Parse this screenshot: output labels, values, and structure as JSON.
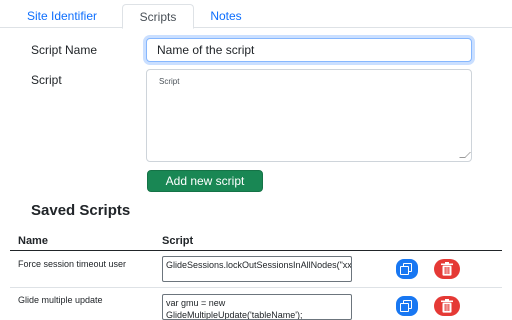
{
  "tabs": [
    {
      "label": "Site Identifier",
      "active": false
    },
    {
      "label": "Scripts",
      "active": true
    },
    {
      "label": "Notes",
      "active": false
    }
  ],
  "form": {
    "script_name_label": "Script Name",
    "script_name_placeholder": "Name of the script",
    "script_label": "Script",
    "script_placeholder": "Script",
    "add_button_label": "Add new script"
  },
  "saved": {
    "title": "Saved Scripts",
    "columns": [
      "Name",
      "Script"
    ],
    "rows": [
      {
        "name": "Force session timeout user",
        "script": "GlideSessions.lockOutSessionsInAllNodes(\"xxxxx\");"
      },
      {
        "name": "Glide multiple update",
        "script": "var gmu = new GlideMultipleUpdate('tableName');"
      }
    ]
  },
  "icons": {
    "copy": "copy-icon",
    "delete": "trash-icon"
  },
  "colors": {
    "accent": "#0d6efd",
    "add_button": "#198754",
    "copy_button": "#1877f2",
    "delete_button": "#e53935"
  }
}
